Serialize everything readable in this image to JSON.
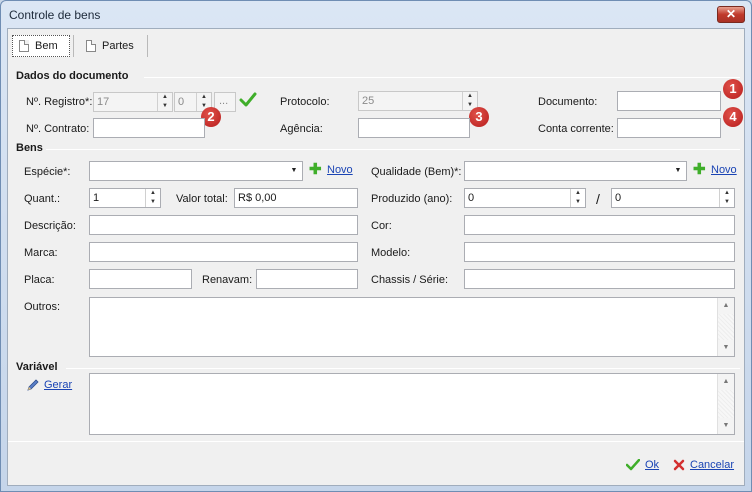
{
  "window": {
    "title": "Controle de bens",
    "close_glyph": "✕"
  },
  "tabs": [
    {
      "label": "Bem",
      "icon": "document-icon"
    },
    {
      "label": "Partes",
      "icon": "document-icon"
    }
  ],
  "dados_documento": {
    "title": "Dados do documento",
    "registro_label": "Nº. Registro*:",
    "registro_value": "17",
    "registro_seq_value": "0",
    "ellipsis": "...",
    "protocolo_label": "Protocolo:",
    "protocolo_value": "25",
    "documento_label": "Documento:",
    "documento_value": "",
    "contrato_label": "Nº. Contrato:",
    "contrato_value": "",
    "agencia_label": "Agência:",
    "agencia_value": "",
    "conta_label": "Conta corrente:",
    "conta_value": ""
  },
  "badges": [
    "1",
    "2",
    "3",
    "4"
  ],
  "bens": {
    "title": "Bens",
    "especie_label": "Espécie*:",
    "especie_value": "",
    "novo_label": "Novo",
    "qualidade_label": "Qualidade (Bem)*:",
    "qualidade_value": "",
    "quant_label": "Quant.:",
    "quant_value": "1",
    "valor_label": "Valor total:",
    "valor_value": "R$ 0,00",
    "produzido_label": "Produzido (ano):",
    "produzido_from": "0",
    "produzido_to": "0",
    "slash": "/",
    "descricao_label": "Descrição:",
    "cor_label": "Cor:",
    "marca_label": "Marca:",
    "modelo_label": "Modelo:",
    "placa_label": "Placa:",
    "renavam_label": "Renavam:",
    "chassis_label": "Chassis / Série:",
    "outros_label": "Outros:"
  },
  "variavel": {
    "title": "Variável",
    "gerar_label": "Gerar"
  },
  "footer": {
    "ok_label": "Ok",
    "cancel_label": "Cancelar"
  },
  "colors": {
    "accent_link": "#1a44b4",
    "badge_red": "#c62828",
    "check_green": "#3fae2a"
  }
}
